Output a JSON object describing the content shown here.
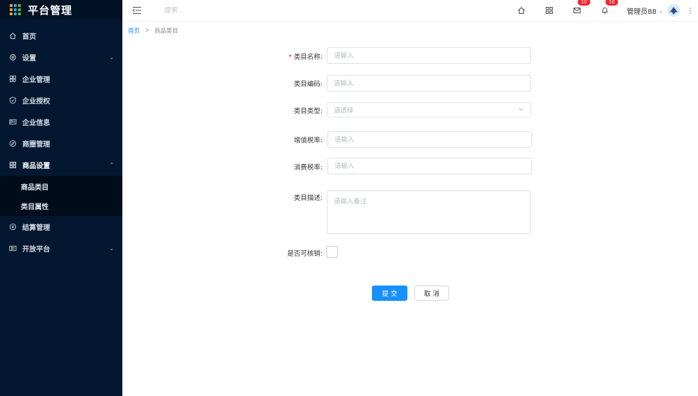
{
  "app": {
    "title": "平台管理",
    "logo_colors": [
      "#f5a623",
      "#2ea7ff",
      "#52c41a",
      "#f5a623",
      "#2ea7ff",
      "#52c41a",
      "#f5a623",
      "#2ea7ff",
      "#52c41a"
    ]
  },
  "sidebar": {
    "items": [
      {
        "label": "首页",
        "icon": "home-icon",
        "arrow": ""
      },
      {
        "label": "设置",
        "icon": "settings-icon",
        "arrow": "⌄"
      },
      {
        "label": "企业管理",
        "icon": "enterprise-icon",
        "arrow": ""
      },
      {
        "label": "企业授权",
        "icon": "shield-icon",
        "arrow": ""
      },
      {
        "label": "企业信息",
        "icon": "id-card-icon",
        "arrow": ""
      },
      {
        "label": "商圈管理",
        "icon": "compass-icon",
        "arrow": ""
      },
      {
        "label": "商品设置",
        "icon": "grid-icon",
        "arrow": "⌃"
      },
      {
        "label": "结算管理",
        "icon": "settlement-icon",
        "arrow": ""
      },
      {
        "label": "开放平台",
        "icon": "platform-icon",
        "arrow": "⌄"
      }
    ],
    "submenu": [
      {
        "label": "商品类目"
      },
      {
        "label": "类目属性"
      }
    ]
  },
  "header": {
    "search_placeholder": "搜索...",
    "mail_badge": "10",
    "bell_badge": "10",
    "user_name": "管理员88"
  },
  "breadcrumb": {
    "home": "首页",
    "separator": ">",
    "current": "商品类目"
  },
  "form": {
    "name_label": "类目名称:",
    "name_required": "*",
    "name_placeholder": "请输入",
    "code_label": "类目编码:",
    "code_placeholder": "请输入",
    "type_label": "类目类型:",
    "type_placeholder": "请选择",
    "vat_label": "增值税率:",
    "vat_placeholder": "请输入",
    "consumption_label": "消费税率:",
    "consumption_placeholder": "请输入",
    "desc_label": "类目描述:",
    "desc_placeholder": "请输入备注",
    "verify_label": "是否可核销:",
    "submit_label": "提交",
    "cancel_label": "取消"
  },
  "colors": {
    "sidebar_bg": "#031830",
    "primary": "#1890ff",
    "badge": "#f5222d"
  }
}
